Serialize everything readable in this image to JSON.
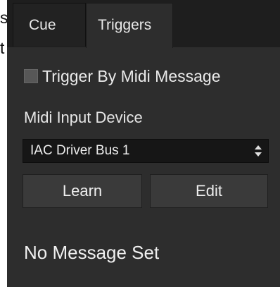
{
  "background_fragments": {
    "first": "s",
    "second": "t"
  },
  "tabs": [
    {
      "label": "Cue",
      "active": false
    },
    {
      "label": "Triggers",
      "active": true
    }
  ],
  "trigger": {
    "checkbox_label": "Trigger By Midi Message",
    "checked": false
  },
  "midi": {
    "device_label": "Midi Input Device",
    "device_selected": "IAC Driver Bus 1"
  },
  "buttons": {
    "learn": "Learn",
    "edit": "Edit"
  },
  "status": "No Message Set",
  "icons": {
    "select": "chevron-up-down-icon"
  },
  "colors": {
    "panel": "#2d2d2d",
    "tabbar": "#1e1e1e",
    "text": "#e6e6e6"
  }
}
